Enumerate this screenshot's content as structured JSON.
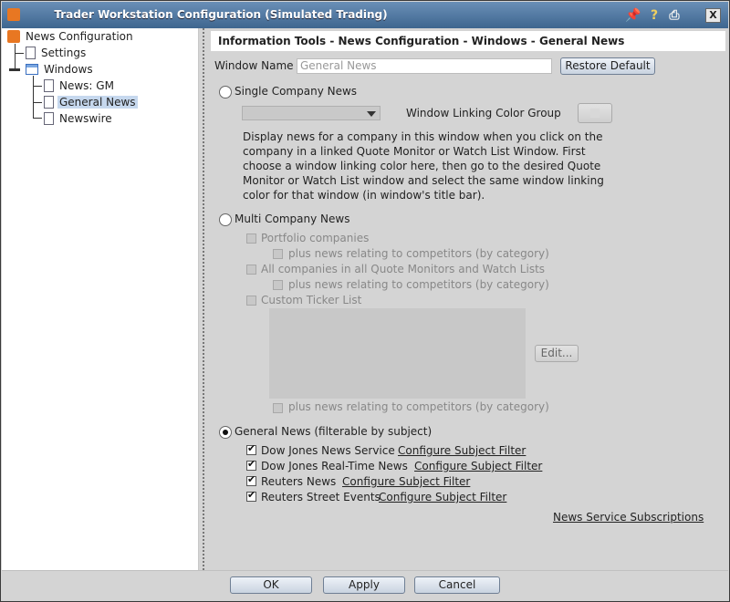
{
  "window": {
    "title": "Trader Workstation Configuration (Simulated Trading)",
    "icons": [
      "pin-icon",
      "help-icon",
      "print-icon",
      "close-icon"
    ],
    "close_label": "X"
  },
  "tree": {
    "root": "News Configuration",
    "settings": "Settings",
    "windows": "Windows",
    "items": [
      "News: GM",
      "General News",
      "Newswire"
    ]
  },
  "pane": {
    "header": "Information Tools - News Configuration - Windows - General News",
    "window_name_label": "Window Name",
    "window_name_placeholder": "General News",
    "restore_default": "Restore Default",
    "single": {
      "label": "Single Company News",
      "linking_label": "Window Linking Color Group",
      "description": "Display news for a company in this window when you click on the company in a linked Quote Monitor or Watch List Window. First choose a window linking color here, then go to the desired Quote Monitor or Watch List window and select the same window linking color for that window (in window's title bar)."
    },
    "multi": {
      "label": "Multi Company News",
      "portfolio": "Portfolio companies",
      "competitors": "plus news relating to competitors (by category)",
      "all_companies": "All companies in all Quote Monitors and Watch Lists",
      "custom": "Custom Ticker List",
      "edit": "Edit..."
    },
    "general": {
      "label": "General News (filterable by subject)",
      "configure": "Configure Subject Filter",
      "services": [
        "Dow Jones News Service",
        "Dow Jones Real-Time News",
        "Reuters News",
        "Reuters Street Events"
      ]
    },
    "subscriptions_link": "News Service Subscriptions"
  },
  "footer": {
    "ok": "OK",
    "apply": "Apply",
    "cancel": "Cancel"
  }
}
